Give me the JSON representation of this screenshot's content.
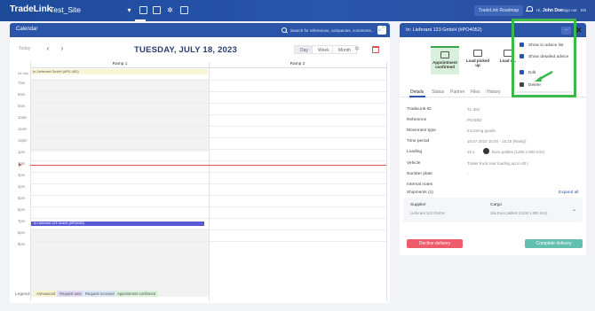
{
  "topbar": {
    "brand": "TradeLink",
    "site": "Test_Site",
    "nav_icons": [
      "chevron-down-icon",
      "calendar-icon",
      "list-icon",
      "gear-icon",
      "document-icon"
    ],
    "roadmap_label": "TradeLink Roadmap",
    "user_lang_prefix": "Hi,",
    "user_name": "John Doe",
    "signout_label": "Sign out",
    "lang": "EN"
  },
  "calendar": {
    "title": "Calendar",
    "search_placeholder": "Search for references, companies, comments...",
    "today_label": "Today",
    "date_label": "TUESDAY, JULY 18, 2023",
    "views": [
      "Day",
      "Week",
      "Month"
    ],
    "active_view": "Day",
    "resources": [
      "Ramp 1",
      "Ramp 2"
    ],
    "allday_label": "All day",
    "times": [
      "7am",
      "8am",
      "9am",
      "10am",
      "11am",
      "12pm",
      "1pm",
      "2pm",
      "3pm",
      "4pm",
      "5pm",
      "6pm",
      "7pm",
      "8pm",
      "9pm"
    ],
    "allday_event": "In Lieferant GmbH (#P0-452)",
    "event_label": "In Lieferant 123 GmbH (#P04052)"
  },
  "legend": {
    "label": "Legend:",
    "items": [
      {
        "label": "Announced",
        "color": "#f8f3cf"
      },
      {
        "label": "Request sent",
        "color": "#dfdbf6"
      },
      {
        "label": "Request received",
        "color": "#dbe8f6"
      },
      {
        "label": "Appointment confirmed",
        "color": "#daf1dc"
      }
    ]
  },
  "details": {
    "title": "In: Lieferant 123 GmbH (#PO4052)",
    "steps": [
      {
        "label": "Appointment confirmed",
        "icon": "calendar-grid-icon"
      },
      {
        "label": "Load picked up",
        "icon": "truck-icon"
      },
      {
        "label": "Load d...",
        "icon": "truck-icon"
      }
    ],
    "tabs": [
      "Details",
      "Status",
      "Partner",
      "Files",
      "History"
    ],
    "fields": [
      {
        "label": "TradeLink-ID",
        "value": "TL-481"
      },
      {
        "label": "Reference",
        "value": "PO4052"
      },
      {
        "label": "Movement type",
        "value": "Incoming goods"
      },
      {
        "label": "Time period",
        "value": "18.07.2023 15:00 - 15:15 (Ramp)"
      },
      {
        "label": "Loading",
        "value": "15 x",
        "value2": "Euro pallets (1200 x 800 mm)"
      },
      {
        "label": "Vehicle",
        "value": "Trailer truck rear loading up to 40 t"
      },
      {
        "label": "Number plate",
        "value": "-"
      },
      {
        "label": "Internal notes",
        "value": ""
      }
    ],
    "shipments_label": "Shipments (1)",
    "expand_all": "Expand all",
    "shipment": {
      "supplier_label": "Supplier",
      "supplier_value": "Lieferant 123 GmbH",
      "cargo_label": "Cargo",
      "cargo_value": "15x Euro pallets (1200 x 800 mm)"
    },
    "decline_label": "Decline delivery",
    "complete_label": "Complete delivery"
  },
  "action_menu": {
    "button_label": "...",
    "items": [
      {
        "label": "Show in advice list",
        "icon": "list-icon"
      },
      {
        "label": "Show detailed advice",
        "icon": "document-icon"
      },
      {
        "label": "Edit",
        "icon": "pencil-icon"
      },
      {
        "label": "Delete",
        "icon": "trash-icon"
      }
    ]
  },
  "colors": {
    "header_blue": "#2a55a8",
    "highlight_green": "#3cb84d",
    "decline_red": "#ef5b6b",
    "complete_teal": "#63bfae",
    "now_line": "#e05656",
    "event_purple": "#5a59d6"
  }
}
